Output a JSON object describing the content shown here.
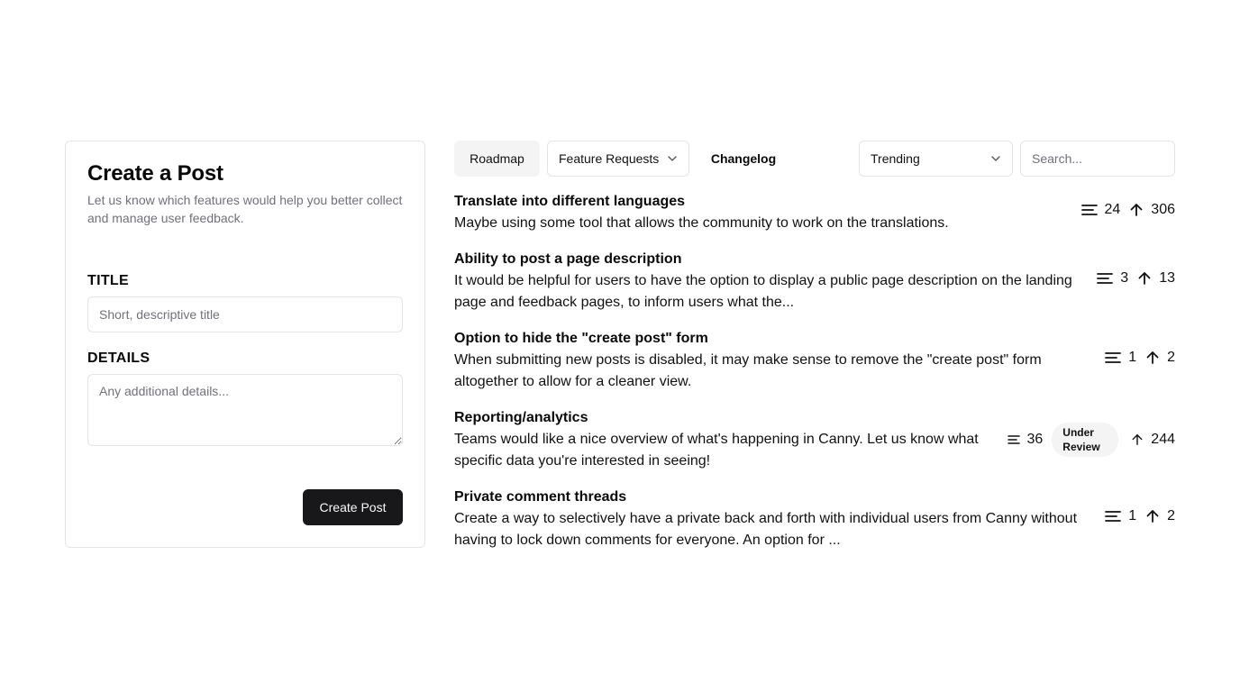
{
  "create_post": {
    "title": "Create a Post",
    "subtitle": "Let us know which features would help you better collect and manage user feedback.",
    "title_label": "TITLE",
    "title_placeholder": "Short, descriptive title",
    "details_label": "DETAILS",
    "details_placeholder": "Any additional details...",
    "submit_label": "Create Post"
  },
  "toolbar": {
    "roadmap_label": "Roadmap",
    "feature_requests_label": "Feature Requests",
    "changelog_label": "Changelog",
    "sort_value": "Trending",
    "search_placeholder": "Search..."
  },
  "posts": [
    {
      "title": "Translate into different languages",
      "description": "Maybe using some tool that allows the community to work on the translations.",
      "comments": "24",
      "votes": "306",
      "status": ""
    },
    {
      "title": "Ability to post a page description",
      "description": "It would be helpful for users to have the option to display a public page description on the landing page and feedback pages, to inform users what the...",
      "comments": "3",
      "votes": "13",
      "status": ""
    },
    {
      "title": "Option to hide the \"create post\" form",
      "description": "When submitting new posts is disabled, it may make sense to remove the \"create post\" form altogether to allow for a cleaner view.",
      "comments": "1",
      "votes": "2",
      "status": ""
    },
    {
      "title": "Reporting/analytics",
      "description": "Teams would like a nice overview of what's happening in Canny. Let us know what specific data you're interested in seeing!",
      "comments": "36",
      "votes": "244",
      "status": "Under Review"
    },
    {
      "title": "Private comment threads",
      "description": "Create a way to selectively have a private back and forth with individual users from Canny without having to lock down comments for everyone. An option for ...",
      "comments": "1",
      "votes": "2",
      "status": ""
    }
  ],
  "icons": {
    "comments": "text-align-left-icon",
    "votes": "arrow-up-icon",
    "dropdown": "chevron-down-icon"
  }
}
